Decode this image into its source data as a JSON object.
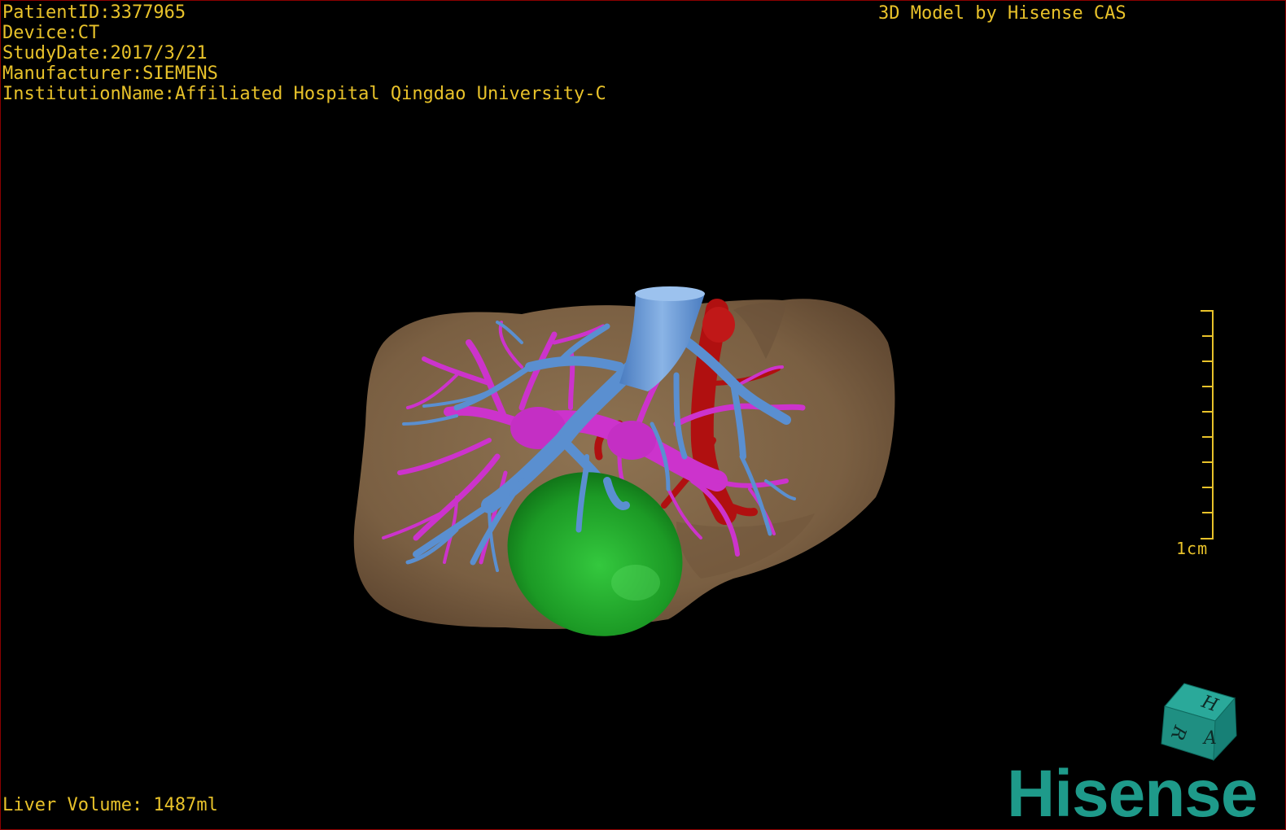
{
  "header": {
    "patient_id": "PatientID:3377965",
    "device": "Device:CT",
    "study_date": "StudyDate:2017/3/21",
    "manufacturer": "Manufacturer:SIEMENS",
    "institution": "InstitutionName:Affiliated Hospital Qingdao University-C"
  },
  "credit": "3D Model by Hisense CAS",
  "footer": {
    "liver_volume": "Liver Volume: 1487ml"
  },
  "scale": {
    "label": "1cm"
  },
  "brand": {
    "logo_text": "Hisense"
  },
  "orientation_cube": {
    "face_labels": [
      "H",
      "R",
      "A"
    ]
  },
  "colors": {
    "overlay_text": "#e8c22a",
    "liver": "#7f6547",
    "portal_vein": "#cc33cc",
    "hepatic_vein": "#5a8fd0",
    "artery": "#b01010",
    "gallbladder": "#1fa42a",
    "brand": "#1e9a8a",
    "frame": "#8b0000"
  },
  "icons": [
    "orientation-cube-icon",
    "scale-bar-icon",
    "hisense-logo-icon"
  ]
}
